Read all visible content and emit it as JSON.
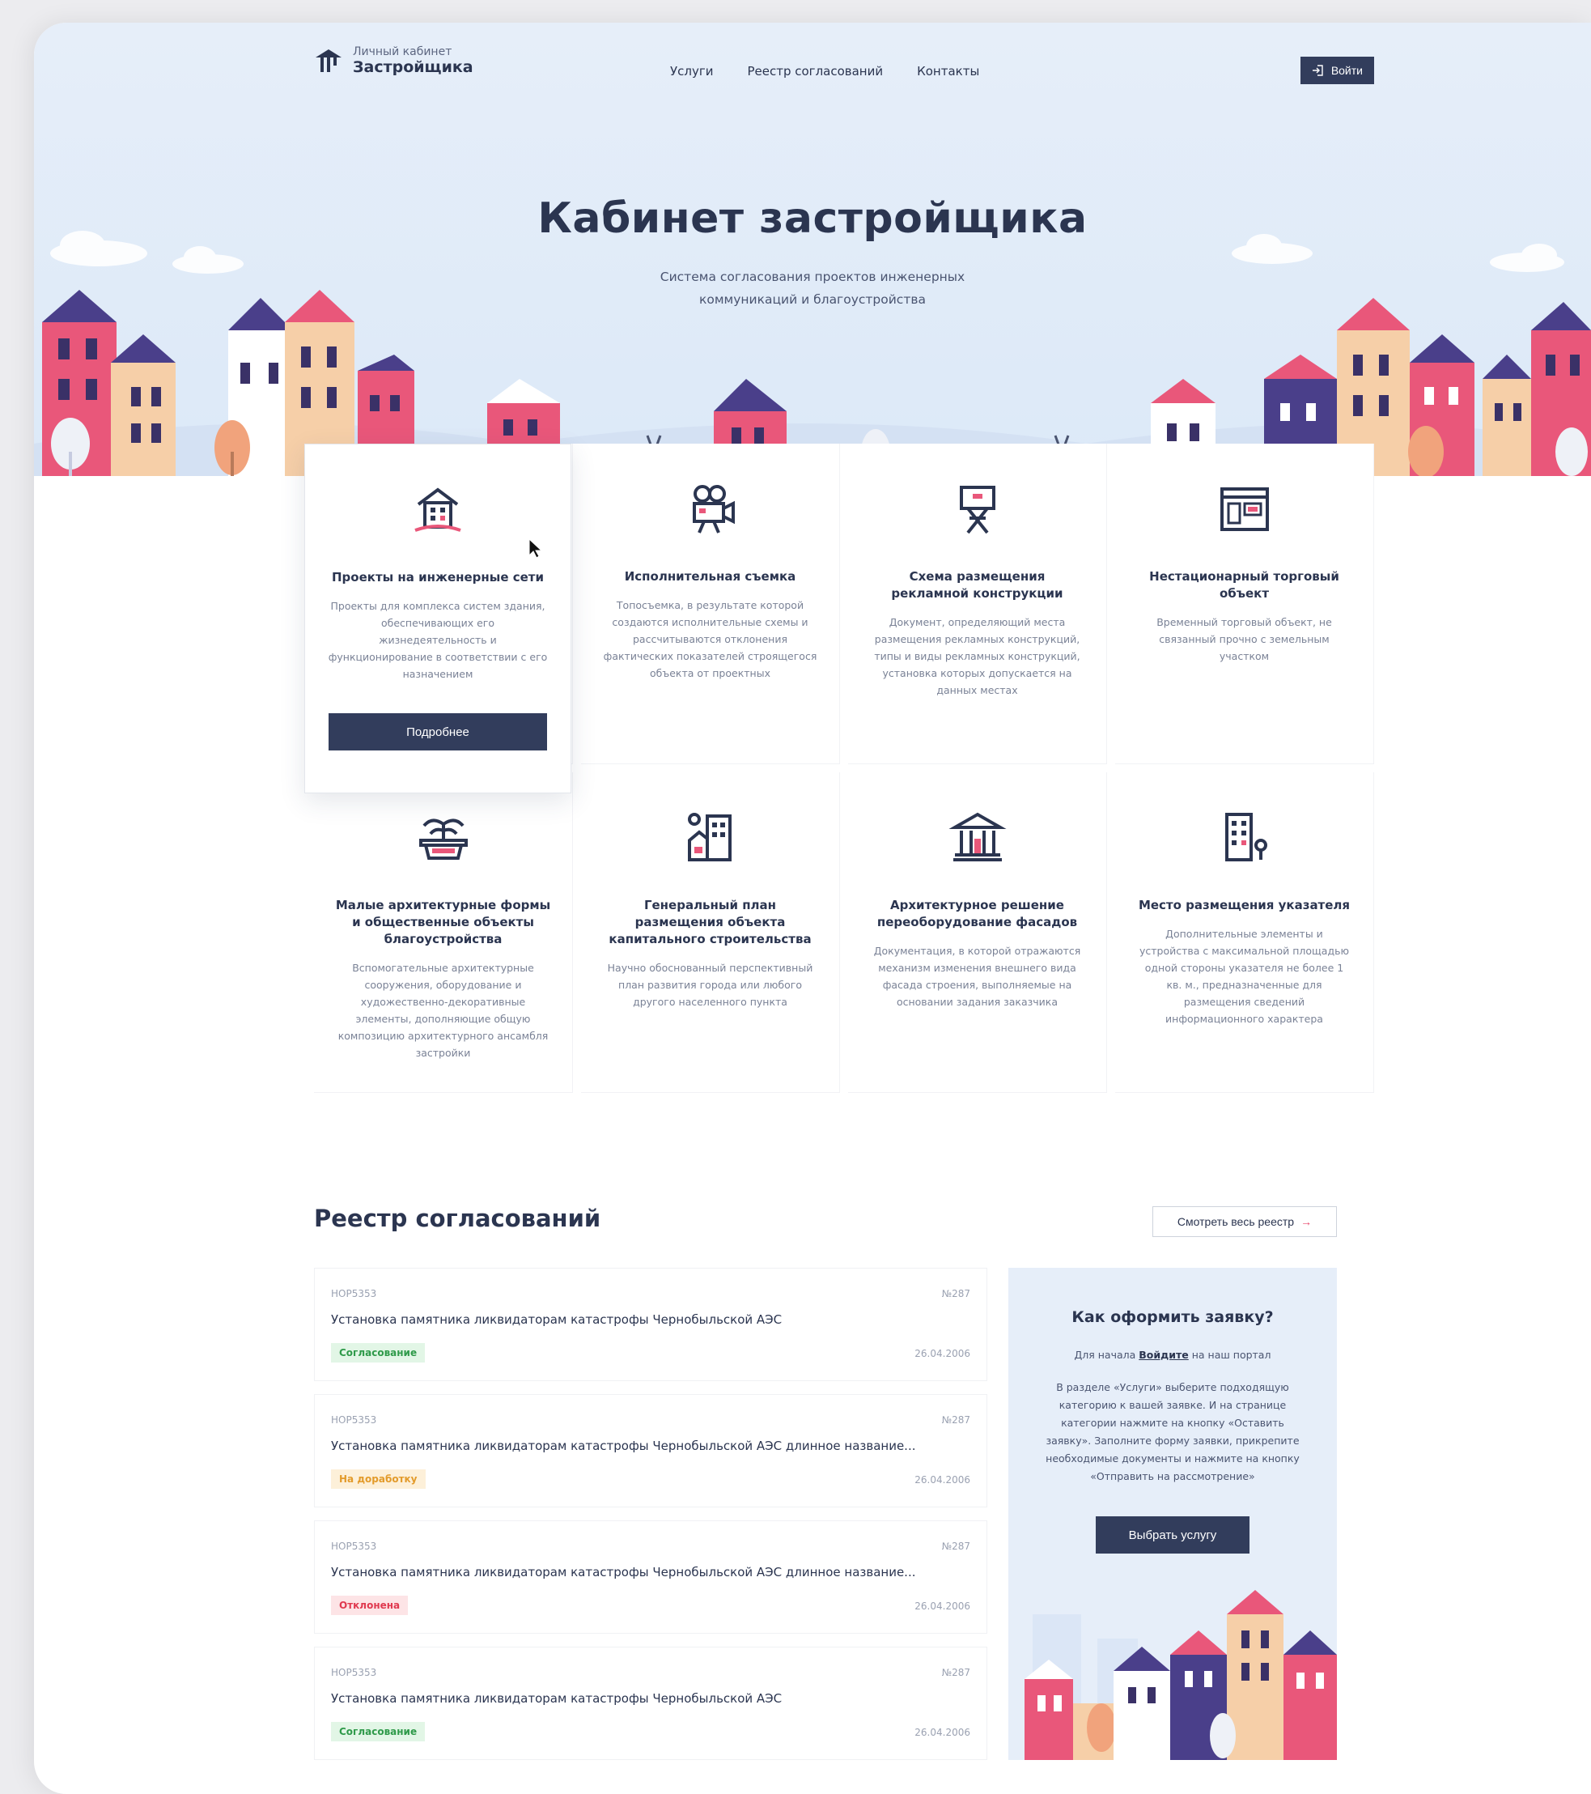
{
  "header": {
    "logo_sub": "Личный кабинет",
    "logo_main": "Застройщика",
    "nav": [
      "Услуги",
      "Реестр согласований",
      "Контакты"
    ],
    "login_label": "Войти"
  },
  "hero": {
    "title": "Кабинет застройщика",
    "subtitle": "Система согласования проектов инженерных коммуникаций и благоустройства"
  },
  "services": [
    {
      "name": "Проекты на инженерные сети",
      "desc": "Проекты для комплекса систем здания, обеспечивающих его жизнедеятельность и функционирование в соответствии с его назначением",
      "icon": "building-icon",
      "button": "Подробнее"
    },
    {
      "name": "Исполнительная съемка",
      "desc": "Топосъемка, в результате которой создаются исполнительные схемы и рассчитываются отклонения фактических показателей строящегося объекта от проектных",
      "icon": "video-camera-icon"
    },
    {
      "name": "Схема размещения рекламной конструкции",
      "desc": "Документ, определяющий места размещения рекламных конструкций, типы и виды рекламных конструкций, установка которых допускается на данных местах",
      "icon": "billboard-icon"
    },
    {
      "name": "Нестационарный торговый объект",
      "desc": "Временный торговый объект, не связанный прочно с земельным участком",
      "icon": "kiosk-icon"
    },
    {
      "name": "Малые архитектурные формы и общественные объекты благоустройства",
      "desc": "Вспомогательные архитектурные сооружения, оборудование и художественно-декоративные элементы, дополняющие общую композицию архитектурного ансамбля застройки",
      "icon": "fountain-icon"
    },
    {
      "name": "Генеральный план размещения объекта капитального строительства",
      "desc": "Научно обоснованный перспективный план развития города или любого другого населенного пункта",
      "icon": "city-plan-icon"
    },
    {
      "name": "Архитектурное решение переоборудование фасадов",
      "desc": "Документация, в которой отражаются механизм изменения внешнего вида фасада строения, выполняемые на основании задания заказчика",
      "icon": "columns-building-icon"
    },
    {
      "name": "Место размещения указателя",
      "desc": "Дополнительные элементы и устройства с максимальной площадью одной стороны указателя не более 1 кв. м., предназначенные для размещения сведений информационного характера",
      "icon": "sign-location-icon"
    }
  ],
  "registry": {
    "title": "Реестр согласований",
    "view_all": "Смотреть весь реестр",
    "rows": [
      {
        "code": "НОР5353",
        "num": "№287",
        "title": "Установка памятника ликвидаторам катастрофы Чернобыльской АЭС",
        "status": "Согласование",
        "date": "26.04.2006",
        "status_color": "green"
      },
      {
        "code": "НОР5353",
        "num": "№287",
        "title": "Установка памятника ликвидаторам катастрофы Чернобыльской АЭС длинное название...",
        "status": "На доработку",
        "date": "26.04.2006",
        "status_color": "yellow"
      },
      {
        "code": "НОР5353",
        "num": "№287",
        "title": "Установка памятника ликвидаторам катастрофы Чернобыльской АЭС длинное название...",
        "status": "Отклонена",
        "date": "26.04.2006",
        "status_color": "red"
      },
      {
        "code": "НОР5353",
        "num": "№287",
        "title": "Установка памятника ликвидаторам катастрофы Чернобыльской АЭС",
        "status": "Согласование",
        "date": "26.04.2006",
        "status_color": "green"
      }
    ]
  },
  "howto": {
    "title": "Как оформить заявку?",
    "p1_prefix": "Для начала",
    "p1_link": "Войдите",
    "p1_suffix": "на наш портал",
    "p2": "В разделе «Услуги» выберите подходящую категорию к вашей заявке. И на странице категории нажмите на кнопку «Оставить заявку». Заполните форму заявки, прикрепите необходимые документы и нажмите на кнопку «Отправить на рассмотрение»",
    "button": "Выбрать услугу"
  },
  "colors": {
    "primary": "#323d5c",
    "sky": "#e6eef9",
    "pink": "#e8476b",
    "purple": "#4a3f8a",
    "peach": "#f6cfa8"
  }
}
